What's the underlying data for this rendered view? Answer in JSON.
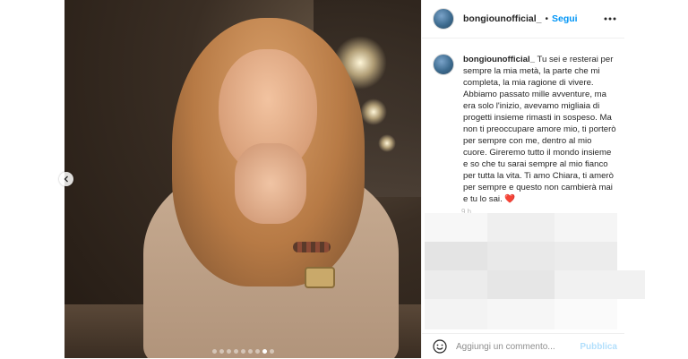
{
  "post": {
    "username": "bongiounofficial_",
    "separator": "•",
    "follow_label": "Segui",
    "more_icon": "more-horizontal-icon",
    "caption": "Tu sei e resterai per sempre la mia metà, la parte che mi completa, la mia ragione di vivere. Abbiamo passato mille avventure, ma era solo l'inizio, avevamo migliaia di progetti insieme rimasti in sospeso. Ma non ti preoccupare amore mio, ti porterò per sempre con me, dentro al mio cuore. Gireremo tutto il mondo insieme e so che tu sarai sempre al mio fianco per tutta la vita. Ti amo Chiara, ti amerò per sempre e questo non cambierà mai e tu lo sai.",
    "caption_emoji": "❤️",
    "faded_time": "9 h",
    "carousel": {
      "total": 9,
      "active_index": 7
    }
  },
  "comment_bar": {
    "emoji_icon": "smiley-icon",
    "placeholder": "Aggiungi un commento...",
    "publish_label": "Pubblica"
  },
  "colors": {
    "accent": "#0095f6",
    "publish_disabled": "#b2dffc",
    "text": "#262626",
    "muted": "#8e8e8e"
  }
}
